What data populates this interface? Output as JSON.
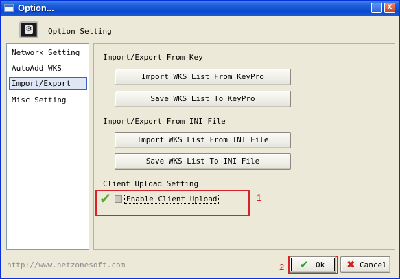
{
  "window": {
    "title": "Option...",
    "controls": [
      "_",
      "□",
      "X"
    ]
  },
  "header": {
    "label": "Option Setting",
    "icon": "gear-icon"
  },
  "sidebar": {
    "items": [
      {
        "label": "Network Setting"
      },
      {
        "label": "AutoAdd WKS"
      },
      {
        "label": "Import/Export",
        "selected": true
      },
      {
        "label": "Misc Setting"
      }
    ]
  },
  "panel": {
    "key_section": {
      "title": "Import/Export From Key",
      "import_button": "Import WKS List From KeyPro",
      "save_button": "Save WKS List To KeyPro"
    },
    "ini_section": {
      "title": "Import/Export From INI File",
      "import_button": "Import WKS List From INI File",
      "save_button": "Save WKS List To INI File"
    },
    "client_section": {
      "title": "Client Upload Setting",
      "checkbox_label": "Enable Client Upload",
      "checked": false
    }
  },
  "annotations": {
    "box1": "1",
    "box2": "2"
  },
  "footer": {
    "url": "http://www.netzonesoft.com",
    "ok_label": "Ok",
    "cancel_label": "Cancel"
  },
  "colors": {
    "titlebar": "#0a4ad2",
    "annotation": "#d8232a",
    "ok_check": "#2a9a2a",
    "cancel_x": "#c8241c"
  }
}
